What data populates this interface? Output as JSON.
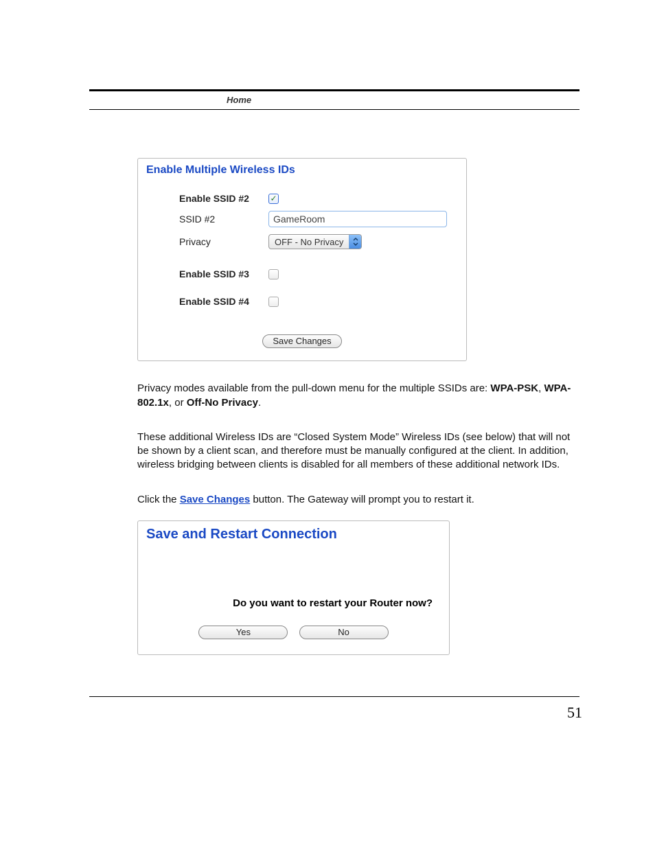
{
  "header": {
    "section": "Home"
  },
  "panel1": {
    "title": "Enable Multiple Wireless IDs",
    "rows": {
      "enable2_label": "Enable SSID #2",
      "ssid2_label": "SSID #2",
      "ssid2_value": "GameRoom",
      "privacy_label": "Privacy",
      "privacy_value": "OFF - No Privacy",
      "enable3_label": "Enable SSID #3",
      "enable4_label": "Enable SSID #4"
    },
    "save_button": "Save Changes"
  },
  "para1": {
    "pre": "Privacy modes available from the pull-down menu for the multiple SSIDs are: ",
    "b1": "WPA-PSK",
    "mid1": ", ",
    "b2": "WPA-802.1x",
    "mid2": ", or ",
    "b3": "Off-No Privacy",
    "post": "."
  },
  "para2": "These additional Wireless IDs are “Closed System Mode” Wireless IDs (see below) that will not be shown by a client scan, and therefore must be manually configured at the client. In addition, wireless bridging between clients is disabled for all members of these additional network IDs.",
  "para3": {
    "pre": "Click the ",
    "link": "Save Changes",
    "post": " button. The Gateway will prompt you to restart it."
  },
  "panel2": {
    "title": "Save and Restart Connection",
    "prompt": "Do you want to restart your Router now?",
    "yes": "Yes",
    "no": "No"
  },
  "page_number": "51"
}
